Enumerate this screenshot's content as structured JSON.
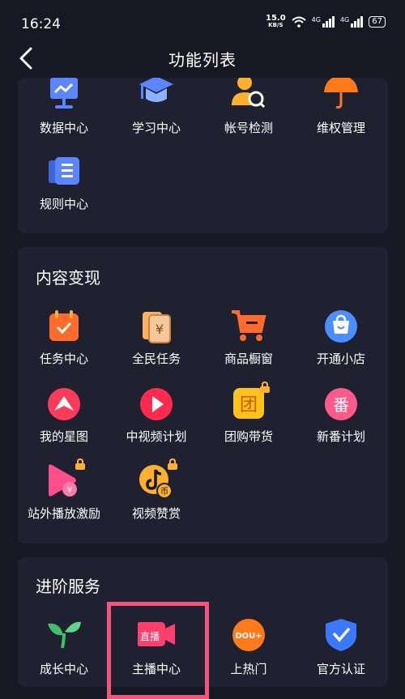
{
  "status": {
    "time": "16:24",
    "speed": "15.0",
    "speed_unit": "KB/S",
    "net1": "4G",
    "net2": "4G",
    "battery": "67"
  },
  "nav": {
    "title": "功能列表"
  },
  "top_section": {
    "items": [
      {
        "label": "数据中心",
        "icon": "data-chart-icon"
      },
      {
        "label": "学习中心",
        "icon": "graduation-cap-icon"
      },
      {
        "label": "帐号检测",
        "icon": "user-search-icon"
      },
      {
        "label": "维权管理",
        "icon": "umbrella-icon"
      },
      {
        "label": "规则中心",
        "icon": "rules-doc-icon"
      }
    ]
  },
  "monetize_section": {
    "title": "内容变现",
    "items": [
      {
        "label": "任务中心",
        "icon": "task-calendar-icon"
      },
      {
        "label": "全民任务",
        "icon": "yuan-card-icon"
      },
      {
        "label": "商品橱窗",
        "icon": "shopping-cart-icon"
      },
      {
        "label": "开通小店",
        "icon": "shop-bag-icon"
      },
      {
        "label": "我的星图",
        "icon": "star-map-icon"
      },
      {
        "label": "中视频计划",
        "icon": "play-video-icon"
      },
      {
        "label": "团购带货",
        "icon": "group-buy-icon"
      },
      {
        "label": "新番计划",
        "icon": "anime-plan-icon"
      },
      {
        "label": "站外播放激励",
        "icon": "offsite-play-icon"
      },
      {
        "label": "视频赞赏",
        "icon": "tiktok-coin-icon"
      }
    ]
  },
  "advanced_section": {
    "title": "进阶服务",
    "items": [
      {
        "label": "成长中心",
        "icon": "sprout-icon"
      },
      {
        "label": "主播中心",
        "icon": "live-camera-icon",
        "badge": "直播"
      },
      {
        "label": "上热门",
        "icon": "dou-plus-icon",
        "badge": "DOU+"
      },
      {
        "label": "官方认证",
        "icon": "verified-shield-icon"
      }
    ]
  },
  "colors": {
    "background": "#161823",
    "card": "#1f2030",
    "highlight": "#f0577a"
  }
}
